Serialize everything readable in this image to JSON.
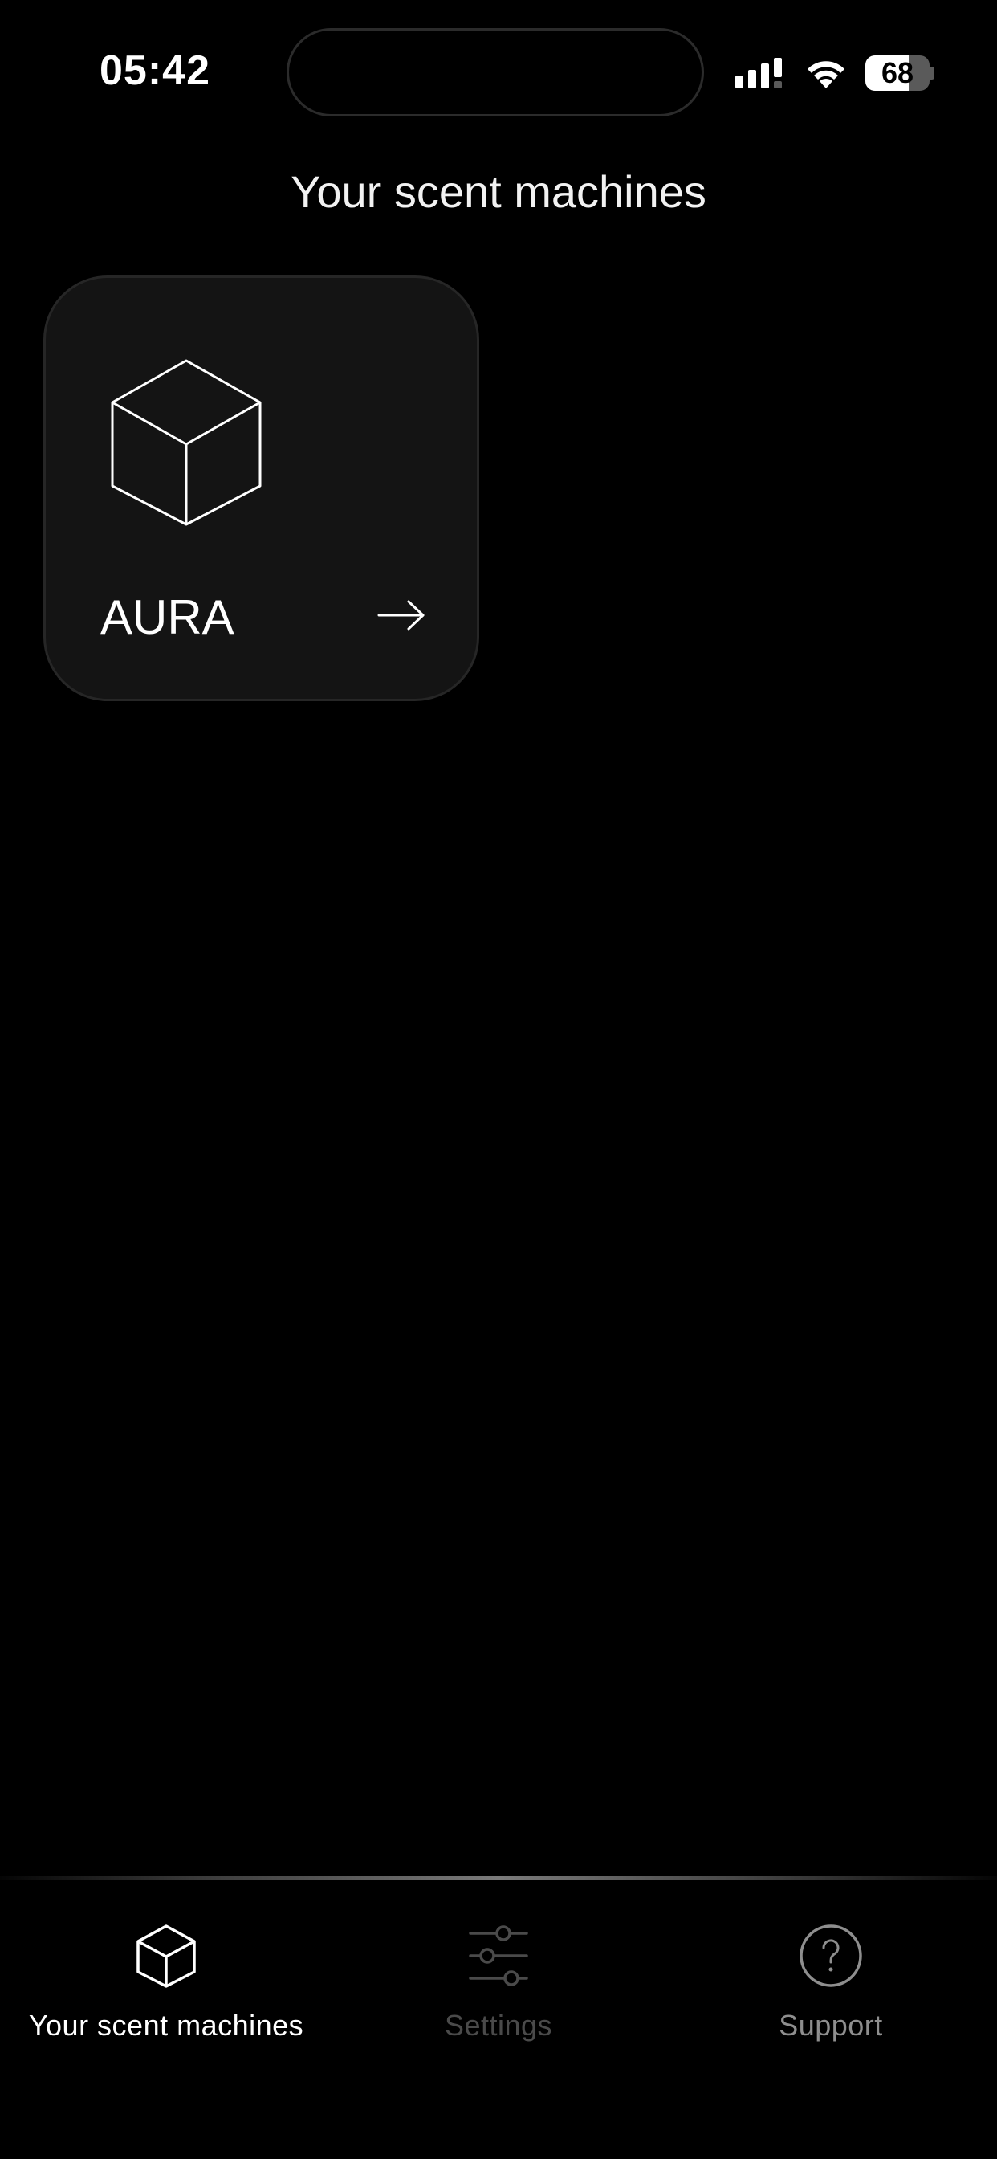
{
  "status_bar": {
    "time": "05:42",
    "battery_level": "68",
    "battery_fraction": 0.68,
    "signal_icon": "cellular-signal-icon",
    "wifi_icon": "wifi-icon"
  },
  "header": {
    "title": "Your scent machines"
  },
  "machines": [
    {
      "name": "AURA",
      "icon": "cube-icon",
      "action_icon": "arrow-right-icon"
    }
  ],
  "tab_bar": {
    "tabs": [
      {
        "label": "Your scent machines",
        "icon": "cube-icon",
        "active": true
      },
      {
        "label": "Settings",
        "icon": "sliders-icon",
        "active": false
      },
      {
        "label": "Support",
        "icon": "help-circle-icon",
        "active": false
      }
    ]
  },
  "colors": {
    "background": "#000000",
    "card_background": "#141414",
    "text_primary": "#ffffff",
    "tab_inactive": "#4a4a4a",
    "tab_support": "#8e8e8e"
  }
}
